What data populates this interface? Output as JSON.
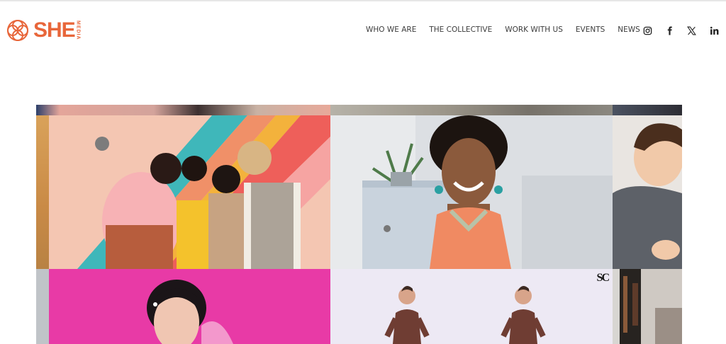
{
  "brand": {
    "logo_word": "SHE",
    "logo_sub": "MEDIA",
    "accent": "#e8663a"
  },
  "nav": {
    "items": [
      "WHO WE ARE",
      "THE COLLECTIVE",
      "WORK WITH US",
      "EVENTS",
      "NEWS"
    ]
  },
  "social": {
    "icons": [
      "instagram-icon",
      "facebook-icon",
      "x-icon",
      "linkedin-icon"
    ]
  },
  "gallery": {
    "watermark": "SC"
  }
}
